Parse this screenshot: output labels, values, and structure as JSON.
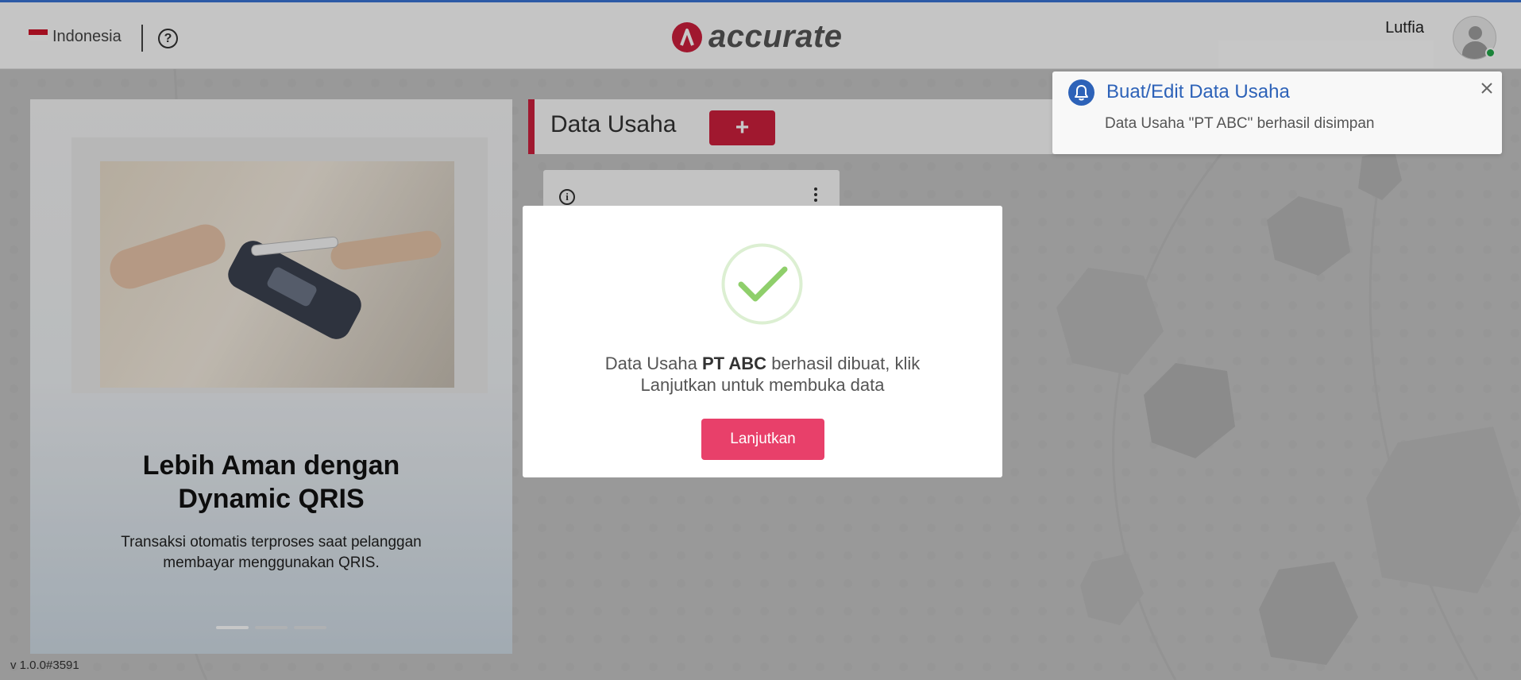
{
  "header": {
    "language": "Indonesia",
    "logo_text": "accurate",
    "username": "Lutfia"
  },
  "promo": {
    "title_line1": "Lebih Aman dengan",
    "title_line2": "Dynamic QRIS",
    "description": "Transaksi otomatis terproses saat pelanggan membayar menggunakan QRIS.",
    "slide_count": 3,
    "active_slide": 1
  },
  "version": "v 1.0.0#3591",
  "data_usaha": {
    "title": "Data Usaha",
    "add_label": "+"
  },
  "toast": {
    "title": "Buat/Edit Data Usaha",
    "message": "Data Usaha \"PT ABC\" berhasil disimpan"
  },
  "modal": {
    "msg_prefix": "Data Usaha ",
    "company": "PT ABC",
    "msg_suffix": " berhasil dibuat, klik Lanjutkan untuk membuka data",
    "button": "Lanjutkan"
  },
  "colors": {
    "brand_red": "#cd1f3d",
    "continue_pink": "#e8406a",
    "toast_blue": "#2d62b8",
    "success_green": "#8fcf6b"
  },
  "icons": [
    "help-icon",
    "logo-icon",
    "avatar-icon",
    "plus-icon",
    "info-icon",
    "kebab-icon",
    "bell-icon",
    "close-icon",
    "check-icon"
  ]
}
